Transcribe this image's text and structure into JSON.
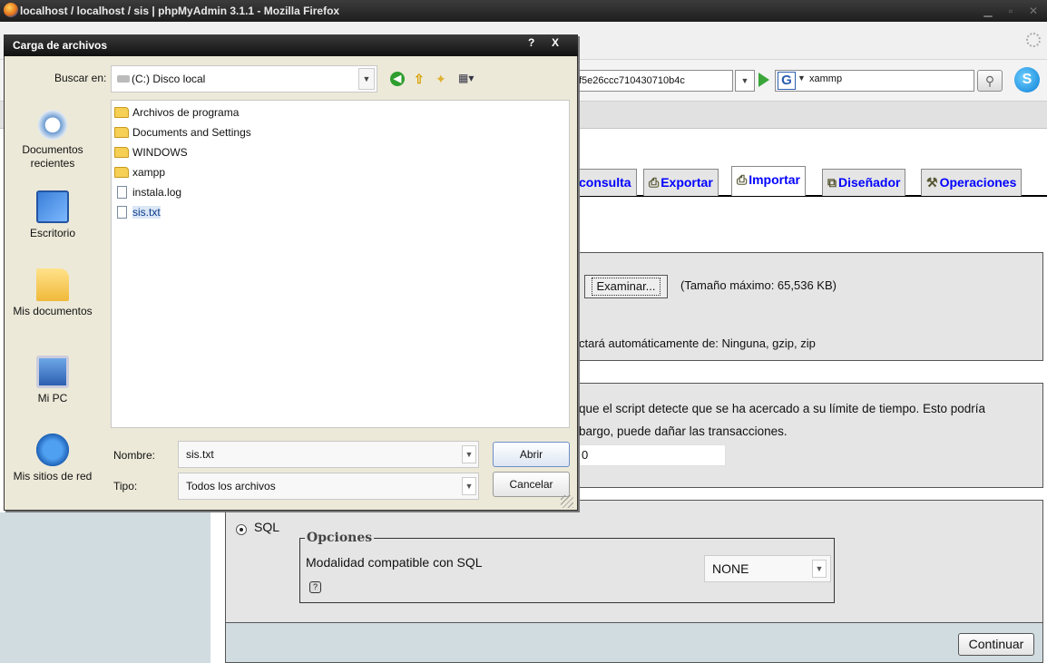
{
  "browser": {
    "window_title": "localhost / localhost / sis | phpMyAdmin 3.1.1 - Mozilla Firefox",
    "url_tail": "f5e26ccc710430710b4c",
    "search_engine_letter": "G",
    "search_text": "xammp"
  },
  "pma": {
    "tabs": [
      {
        "label": "consulta"
      },
      {
        "label": "Exportar",
        "icon": "export-icon"
      },
      {
        "label": "Importar",
        "icon": "import-icon",
        "active": true
      },
      {
        "label": "Diseñador",
        "icon": "designer-icon"
      },
      {
        "label": "Operaciones",
        "icon": "operations-icon"
      }
    ],
    "browse_button": "Examinar...",
    "max_size": "(Tamaño máximo: 65,536 KB)",
    "compression_note": "ctará automáticamente de: Ninguna, gzip, zip",
    "partial_line1": "que el script detecte que se ha acercado a su límite de tiempo. Esto podría",
    "partial_line2": "bargo, puede dañar las transacciones.",
    "skip_value": "0",
    "format": {
      "radio_label": "SQL",
      "options_legend": "Opciones",
      "compat_label": "Modalidad compatible con SQL",
      "compat_value": "NONE",
      "help_icon": "?"
    },
    "continue_button": "Continuar"
  },
  "dialog": {
    "title": "Carga de archivos",
    "help_label": "?",
    "close_label": "X",
    "look_in_label": "Buscar en:",
    "look_in_value": "(C:) Disco local",
    "places": [
      {
        "label": "Documentos recientes",
        "icon": "recent-documents-icon"
      },
      {
        "label": "Escritorio",
        "icon": "desktop-icon"
      },
      {
        "label": "Mis documentos",
        "icon": "my-documents-icon"
      },
      {
        "label": "Mi PC",
        "icon": "my-computer-icon"
      },
      {
        "label": "Mis sitios de red",
        "icon": "network-places-icon"
      }
    ],
    "files": [
      {
        "name": "Archivos de programa",
        "kind": "folder"
      },
      {
        "name": "Documents and Settings",
        "kind": "folder"
      },
      {
        "name": "WINDOWS",
        "kind": "folder"
      },
      {
        "name": "xampp",
        "kind": "folder"
      },
      {
        "name": "instala.log",
        "kind": "file"
      },
      {
        "name": "sis.txt",
        "kind": "file",
        "selected": true
      }
    ],
    "name_label": "Nombre:",
    "name_value": "sis.txt",
    "type_label": "Tipo:",
    "type_value": "Todos los archivos",
    "open_button": "Abrir",
    "cancel_button": "Cancelar"
  }
}
